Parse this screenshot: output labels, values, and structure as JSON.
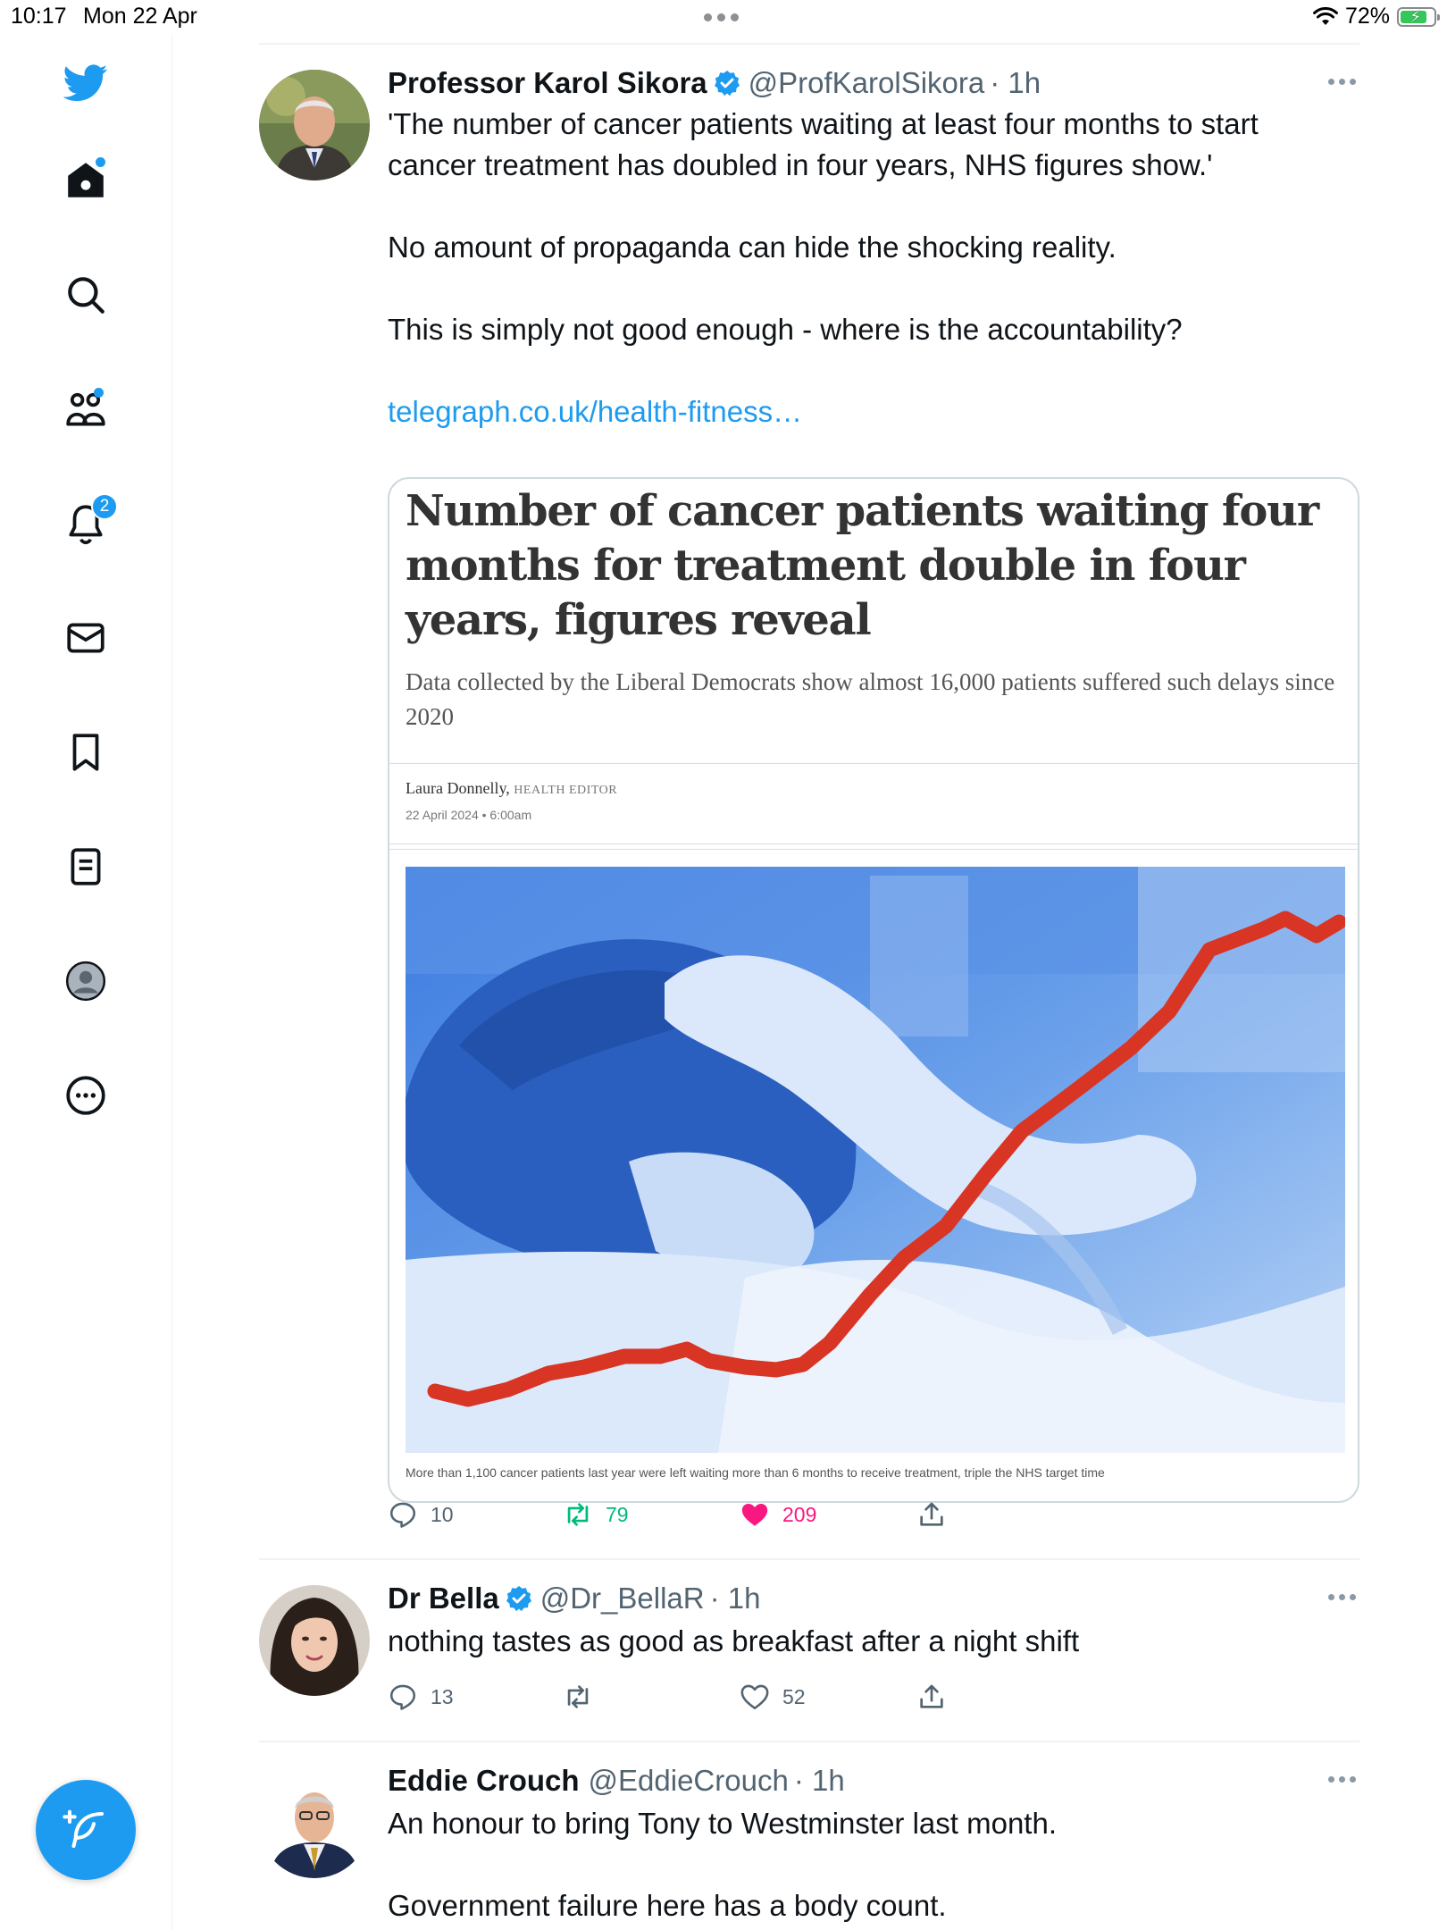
{
  "status_bar": {
    "time": "10:17",
    "date": "Mon 22 Apr",
    "battery": "72%"
  },
  "sidebar": {
    "items": [
      {
        "name": "home",
        "icon": "home-icon"
      },
      {
        "name": "explore",
        "icon": "search-icon"
      },
      {
        "name": "communities",
        "icon": "communities-icon"
      },
      {
        "name": "notifications",
        "icon": "bell-icon",
        "badge": "2"
      },
      {
        "name": "messages",
        "icon": "mail-icon"
      },
      {
        "name": "bookmarks",
        "icon": "bookmark-icon"
      },
      {
        "name": "lists",
        "icon": "list-icon"
      },
      {
        "name": "profile",
        "icon": "profile-icon"
      },
      {
        "name": "more",
        "icon": "more-circle-icon"
      }
    ],
    "compose_icon": "compose-icon"
  },
  "colors": {
    "accent": "#1d9bf0",
    "retweet": "#00ba7c",
    "like": "#f91880",
    "chart_line": "#d83524"
  },
  "tweets": [
    {
      "name": "Professor Karol Sikora",
      "handle": "@ProfKarolSikora",
      "time": "· 1h",
      "text": [
        "'The number of cancer patients waiting at least four months to start",
        "cancer treatment has doubled in four years, NHS figures show.'",
        "",
        "No amount of propaganda can hide the shocking reality.",
        "",
        "This is simply not good enough - where is the accountability?",
        ""
      ],
      "link": "telegraph.co.uk/health-fitness…",
      "card": {
        "headline": "Number of cancer patients waiting four months for treatment double in four years, figures reveal",
        "standfirst": "Data collected by the Liberal Democrats show almost 16,000 patients suffered such delays since 2020",
        "author": "Laura Donnelly,",
        "role": "HEALTH EDITOR",
        "date": "22 April 2024 • 6:00am",
        "caption": "More than 1,100 cancer patients last year were left waiting more than 6 months to receive treatment, triple the NHS target time"
      },
      "replies": "10",
      "retweets": "79",
      "likes": "209",
      "liked": true,
      "retweeted": true
    },
    {
      "name": "Dr Bella",
      "handle": "@Dr_BellaR",
      "time": "· 1h",
      "text": [
        "nothing tastes as good as breakfast after a night shift"
      ],
      "replies": "13",
      "retweets": "",
      "likes": "52"
    },
    {
      "name": "Eddie Crouch",
      "handle": "@EddieCrouch",
      "time": "· 1h",
      "text": [
        "An honour to bring Tony to Westminster last month.",
        "",
        "Government failure here has a body count."
      ]
    }
  ]
}
